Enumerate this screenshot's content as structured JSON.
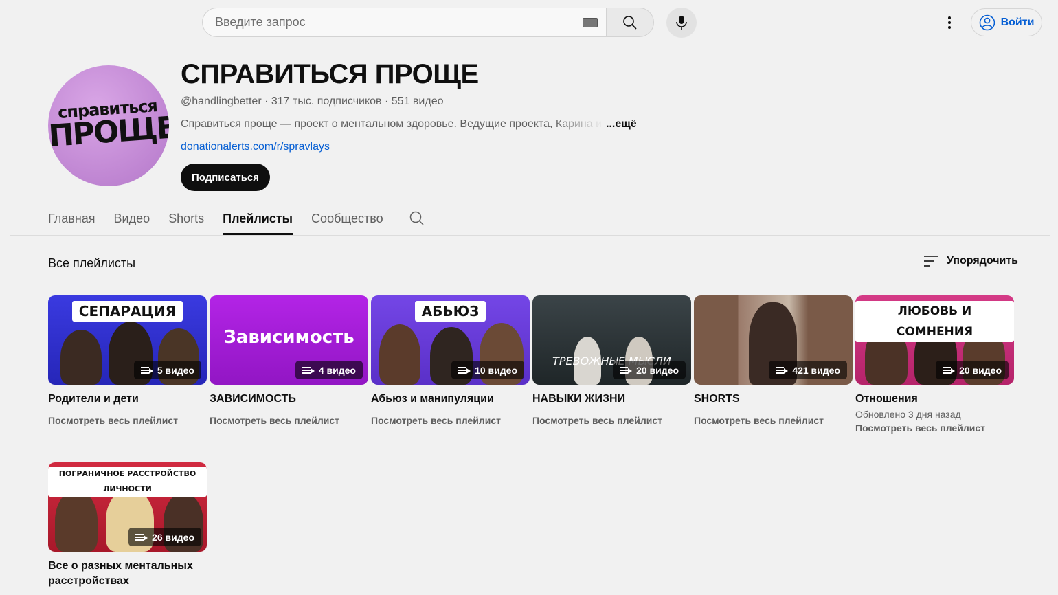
{
  "topbar": {
    "search_placeholder": "Введите запрос",
    "signin_label": "Войти",
    "icons": [
      "keyboard-icon",
      "search-icon",
      "mic-icon",
      "more-vert-icon",
      "account-icon"
    ]
  },
  "channel": {
    "avatar_text_line1": "справиться",
    "avatar_text_line2": "ПРОЩЕ",
    "title": "СПРАВИТЬСЯ ПРОЩЕ",
    "meta": "@handlingbetter · 317 тыс. подписчиков · 551 видео",
    "description": "Справиться проще — проект о ментальном здоровье. Ведущие проекта, Карина и На",
    "more_label": "...ещё",
    "link": "donationalerts.com/r/spravlays",
    "subscribe_label": "Подписаться",
    "avatar_color": "#c58fd8"
  },
  "tabs": [
    {
      "label": "Главная",
      "active": false
    },
    {
      "label": "Видео",
      "active": false
    },
    {
      "label": "Shorts",
      "active": false
    },
    {
      "label": "Плейлисты",
      "active": true
    },
    {
      "label": "Сообщество",
      "active": false
    }
  ],
  "section": {
    "title": "Все плейлисты",
    "sort_label": "Упорядочить"
  },
  "playlists": [
    {
      "title": "Родители и дети",
      "count": "5 видео",
      "thumb_text": "СЕПАРАЦИЯ",
      "updated": "",
      "link": "Посмотреть весь плейлист",
      "color": "#2f2fd0"
    },
    {
      "title": "ЗАВИСИМОСТЬ",
      "count": "4 видео",
      "thumb_text": "Зависимость",
      "updated": "",
      "link": "Посмотреть весь плейлист",
      "color": "#a21bd6"
    },
    {
      "title": "Абьюз и манипуляции",
      "count": "10 видео",
      "thumb_text": "АБЬЮЗ",
      "updated": "",
      "link": "Посмотреть весь плейлист",
      "color": "#6a3fd9"
    },
    {
      "title": "НАВЫКИ ЖИЗНИ",
      "count": "20 видео",
      "thumb_text": "ТРЕВОЖНЫЕ МЫСЛИ",
      "updated": "",
      "link": "Посмотреть весь плейлист",
      "color": "#2b3336"
    },
    {
      "title": "SHORTS",
      "count": "421 видео",
      "thumb_text": "",
      "updated": "",
      "link": "Посмотреть весь плейлист",
      "color": "#7a5a48"
    },
    {
      "title": "Отношения",
      "count": "20 видео",
      "thumb_text": "ЛЮБОВЬ И СОМНЕНИЯ",
      "updated": "Обновлено 3 дня назад",
      "link": "Посмотреть весь плейлист",
      "color": "#c72e78"
    },
    {
      "title": "Все о разных ментальных расстройствах",
      "count": "26 видео",
      "thumb_text": "ПОГРАНИЧНОЕ РАССТРОЙСТВО ЛИЧНОСТИ",
      "updated": "",
      "link": "",
      "color": "#c21f36"
    }
  ]
}
